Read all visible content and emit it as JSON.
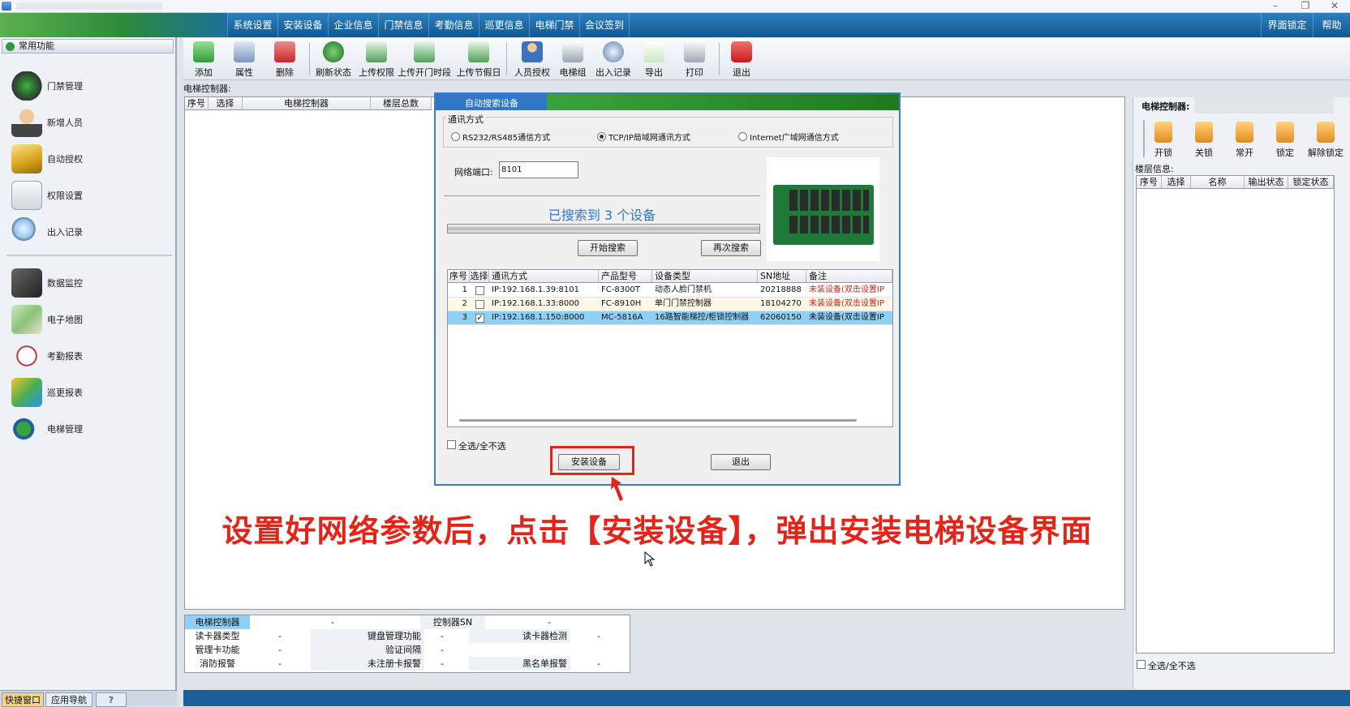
{
  "menu": [
    "系统设置",
    "安装设备",
    "企业信息",
    "门禁信息",
    "考勤信息",
    "巡更信息",
    "电梯门禁",
    "会议签到"
  ],
  "menu_right": [
    "界面锁定",
    "帮助"
  ],
  "sidebar": {
    "header": "常用功能",
    "items_top": [
      "门禁管理",
      "新增人员",
      "自动授权",
      "权限设置",
      "出入记录"
    ],
    "items_bottom": [
      "数据监控",
      "电子地图",
      "考勤报表",
      "巡更报表",
      "电梯管理"
    ],
    "tabs": [
      "快捷窗口",
      "应用导航",
      "?"
    ]
  },
  "toolbar": [
    "添加",
    "属性",
    "删除",
    "刷新状态",
    "上传权限",
    "上传开门时段",
    "上传节假日",
    "人员授权",
    "电梯组",
    "出入记录",
    "导出",
    "打印",
    "退出"
  ],
  "left_panel": {
    "label": "电梯控制器:",
    "columns": [
      "序号",
      "选择",
      "电梯控制器",
      "楼层总数"
    ]
  },
  "right_panel": {
    "controller_label": "电梯控制器:",
    "buttons": [
      "开锁",
      "关锁",
      "常开",
      "锁定",
      "解除锁定"
    ],
    "floor_label": "楼层信息:",
    "columns": [
      "序号",
      "选择",
      "名称",
      "输出状态",
      "锁定状态"
    ],
    "select_all": "全选/全不选"
  },
  "dialog": {
    "title": "自动搜索设备",
    "group_label": "通讯方式",
    "options": [
      "RS232/RS485通信方式",
      "TCP/IP局域网通讯方式",
      "Internet广域网通信方式"
    ],
    "selected_option": 1,
    "port_label": "网络端口:",
    "port_value": "8101",
    "found_text": "已搜索到  3 个设备",
    "btn_start": "开始搜索",
    "btn_again": "再次搜索",
    "columns": [
      "序号",
      "选择",
      "通讯方式",
      "产品型号",
      "设备类型",
      "SN地址",
      "备注"
    ],
    "rows": [
      {
        "no": "1",
        "checked": false,
        "comm": "IP:192.168.1.39:8101",
        "model": "FC-8300T",
        "type": "动态人脸门禁机",
        "sn": "20218888",
        "note": "未装设备(双击设置IP"
      },
      {
        "no": "2",
        "checked": false,
        "comm": "IP:192.168.1.33:8000",
        "model": "FC-8910H",
        "type": "单门门禁控制器",
        "sn": "18104270",
        "note": "未装设备(双击设置IP"
      },
      {
        "no": "3",
        "checked": true,
        "comm": "IP:192.168.1.150:8000",
        "model": "MC-5816A",
        "type": "16路智能梯控/柜锁控制器",
        "sn": "62060150",
        "note": "未装设备(双击设置IP"
      }
    ],
    "select_all": "全选/全不选",
    "btn_install": "安装设备",
    "btn_exit": "退出"
  },
  "info_table": {
    "rows": [
      [
        "电梯控制器",
        "-",
        "控制器SN",
        "-"
      ],
      [
        "读卡器类型",
        "-",
        "键盘管理功能",
        "-",
        "读卡器检测",
        "-"
      ],
      [
        "管理卡功能",
        "-",
        "验证间隔",
        "-"
      ],
      [
        "消防报警",
        "-",
        "未注册卡报警",
        "-",
        "黑名单报警",
        "-"
      ]
    ]
  },
  "caption": "设置好网络参数后，点击【安装设备】，弹出安装电梯设备界面",
  "colors": {
    "accent_blue": "#1a5f98",
    "annotation_red": "#e32419",
    "selected_row": "#8fd0f5",
    "note_red": "#c0281e"
  }
}
